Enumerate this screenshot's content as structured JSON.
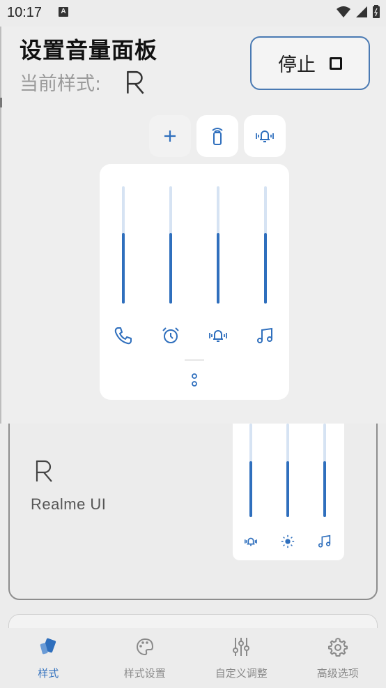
{
  "status_bar": {
    "time": "10:17",
    "notification_letter": "A",
    "icons": [
      "wifi-icon",
      "signal-icon",
      "battery-icon"
    ]
  },
  "header": {
    "title": "设置音量面板",
    "current_style_label": "当前样式:",
    "stop_button_label": "停止"
  },
  "toolbar": {
    "buttons": [
      "add-icon",
      "ringer-icon",
      "vibrate-icon"
    ]
  },
  "volume_panel": {
    "sliders": [
      {
        "name": "call",
        "icon": "phone-icon",
        "level": 0.6
      },
      {
        "name": "alarm",
        "icon": "alarm-icon",
        "level": 0.6
      },
      {
        "name": "vibrate",
        "icon": "vibrate-icon",
        "level": 0.6
      },
      {
        "name": "media",
        "icon": "music-note-icon",
        "level": 0.6
      }
    ],
    "more_icon": "more-vertical-icon"
  },
  "style_card": {
    "name": "Realme UI",
    "preview_sliders": [
      {
        "icon": "vibrate-icon",
        "level": 0.6
      },
      {
        "icon": "brightness-icon",
        "level": 0.6
      },
      {
        "icon": "music-note-icon",
        "level": 0.6
      }
    ]
  },
  "bottom_nav": {
    "items": [
      {
        "label": "样式",
        "icon": "style-icon",
        "active": true
      },
      {
        "label": "样式设置",
        "icon": "palette-icon",
        "active": false
      },
      {
        "label": "自定义调整",
        "icon": "tune-icon",
        "active": false
      },
      {
        "label": "高级选项",
        "icon": "gear-icon",
        "active": false
      }
    ]
  },
  "colors": {
    "accent": "#2f6fbd",
    "slider_track": "#d6e3f3",
    "background": "#ececec"
  }
}
